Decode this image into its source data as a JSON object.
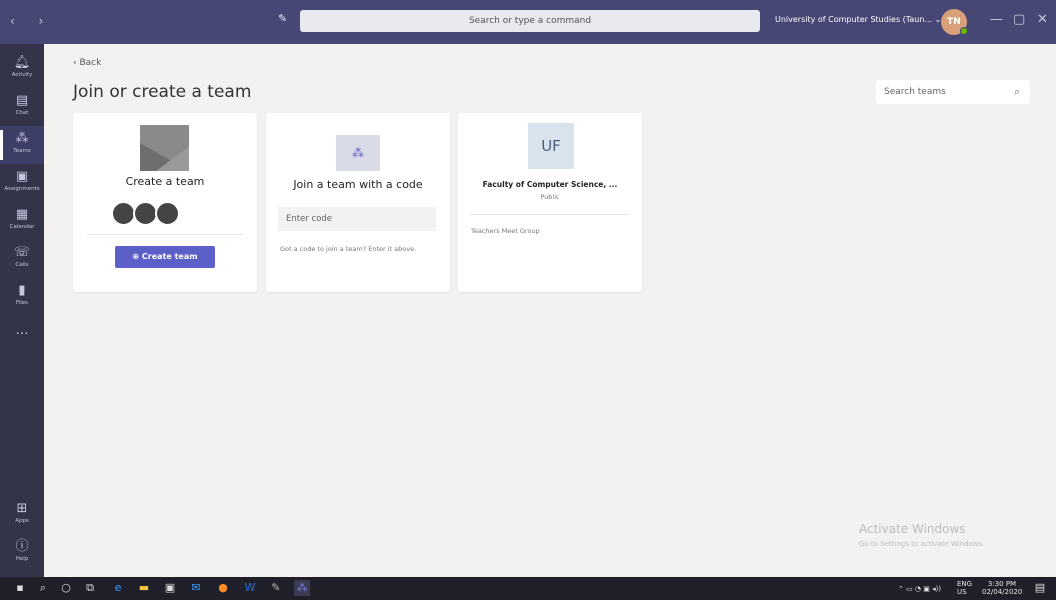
{
  "titlebar": {
    "search_placeholder": "Search or type a command",
    "org_label": "University of Computer Studies (Taun... ⌄",
    "avatar_initials": "TN",
    "colors": {
      "bar": "#464775",
      "accent": "#5b5fc7"
    }
  },
  "rail": {
    "items": [
      {
        "label": "Activity",
        "icon": "bell-icon"
      },
      {
        "label": "Chat",
        "icon": "chat-icon"
      },
      {
        "label": "Teams",
        "icon": "teams-icon",
        "active": true
      },
      {
        "label": "Assignments",
        "icon": "assignments-icon"
      },
      {
        "label": "Calendar",
        "icon": "calendar-icon"
      },
      {
        "label": "Calls",
        "icon": "phone-icon"
      },
      {
        "label": "Files",
        "icon": "files-icon"
      },
      {
        "label": "…",
        "icon": "more-icon"
      }
    ],
    "bottom": [
      {
        "label": "Apps",
        "icon": "apps-icon"
      },
      {
        "label": "Help",
        "icon": "help-icon"
      }
    ]
  },
  "main": {
    "back_label": "Back",
    "title": "Join or create a team",
    "search_teams_placeholder": "Search teams"
  },
  "cards": {
    "create": {
      "title": "Create a team",
      "button": "Create team"
    },
    "join": {
      "title": "Join a team with a code",
      "input_placeholder": "Enter code",
      "help": "Got a code to join a team? Enter it above."
    },
    "team": {
      "initials": "UF",
      "name": "Faculty of Computer Science, ...",
      "visibility": "Public",
      "description": "Teachers Meet Group"
    }
  },
  "watermark": {
    "line1": "Activate Windows",
    "line2": "Go to Settings to activate Windows."
  },
  "taskbar": {
    "lang": "ENG",
    "region": "US",
    "time": "3:30 PM",
    "date": "02/04/2020"
  }
}
